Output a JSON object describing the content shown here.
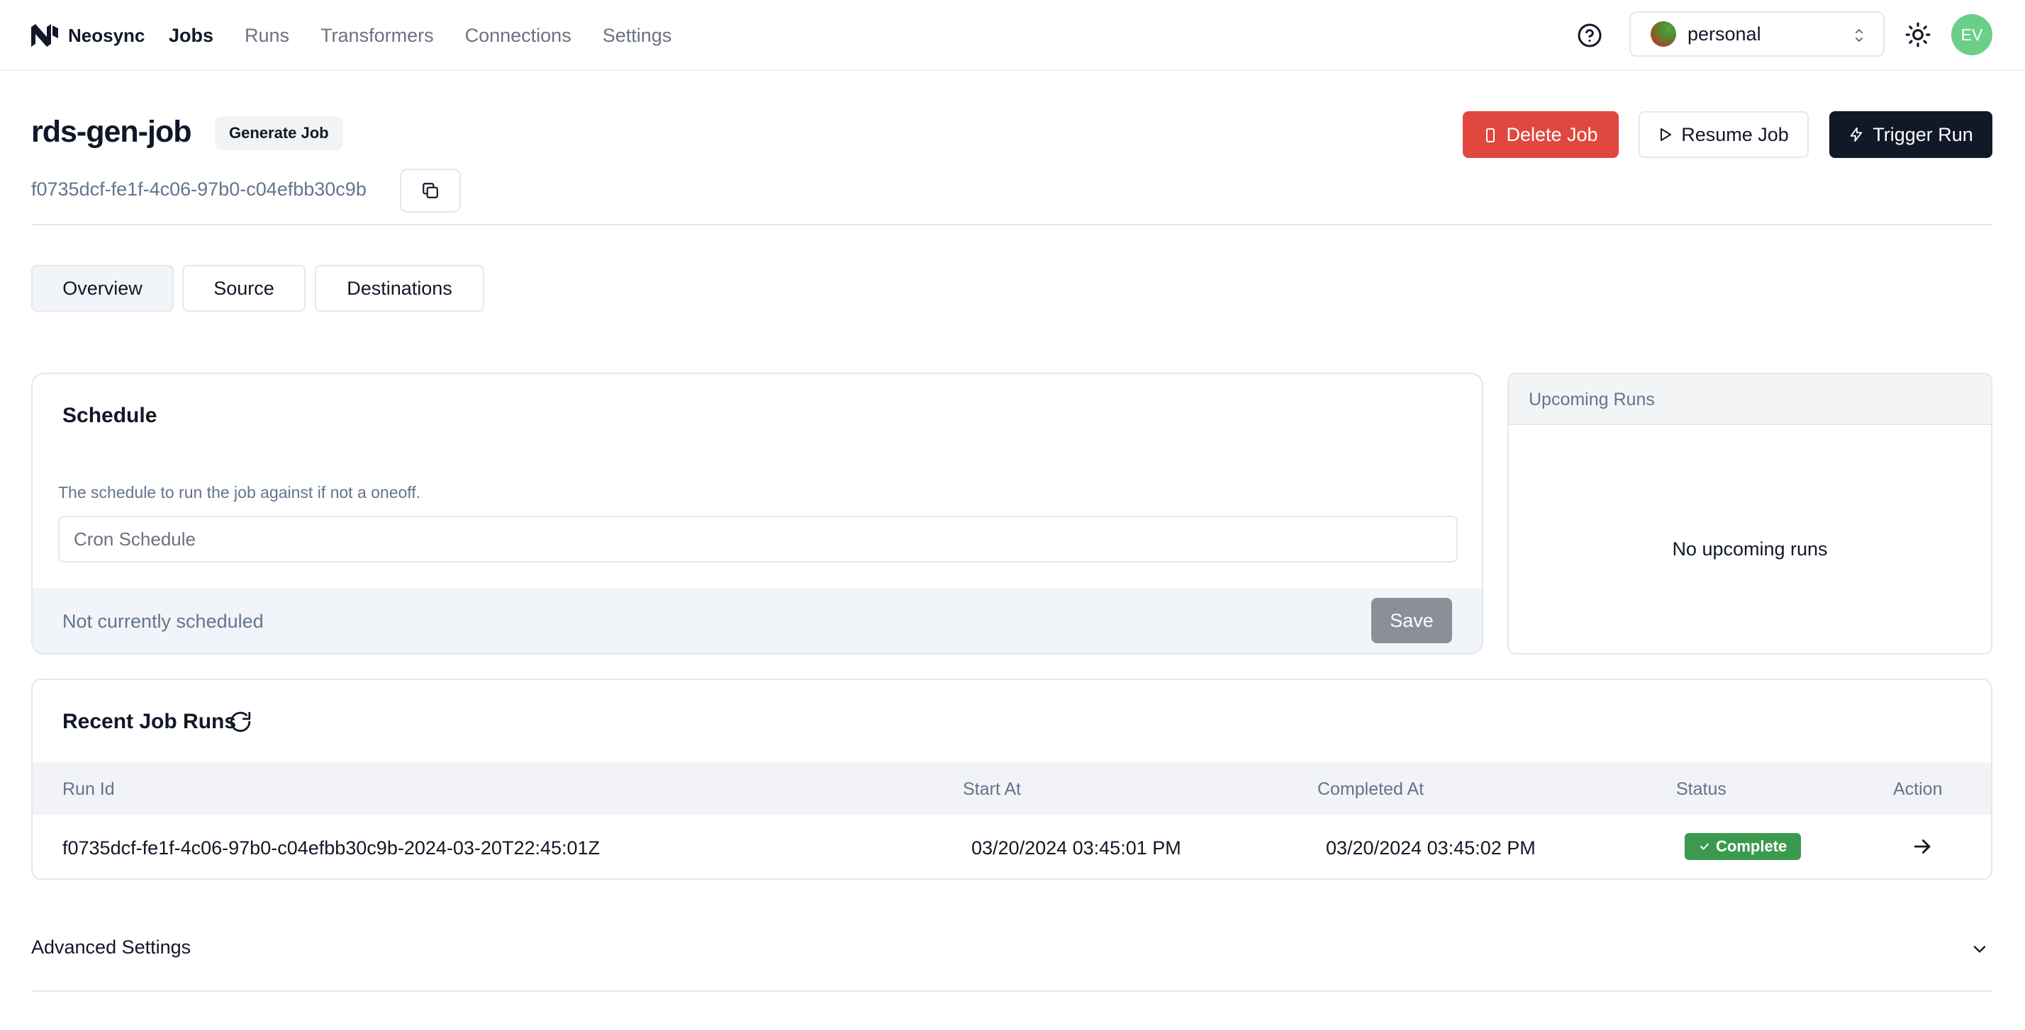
{
  "brand": {
    "name": "Neosync"
  },
  "nav": {
    "items": [
      {
        "label": "Jobs",
        "active": true
      },
      {
        "label": "Runs",
        "active": false
      },
      {
        "label": "Transformers",
        "active": false
      },
      {
        "label": "Connections",
        "active": false
      },
      {
        "label": "Settings",
        "active": false
      }
    ]
  },
  "account": {
    "name": "personal",
    "avatar_initials": "EV"
  },
  "job": {
    "name": "rds-gen-job",
    "type_badge": "Generate Job",
    "id": "f0735dcf-fe1f-4c06-97b0-c04efbb30c9b"
  },
  "actions": {
    "delete_label": "Delete Job",
    "resume_label": "Resume Job",
    "trigger_label": "Trigger Run"
  },
  "tabs": [
    {
      "label": "Overview",
      "active": true
    },
    {
      "label": "Source",
      "active": false
    },
    {
      "label": "Destinations",
      "active": false
    }
  ],
  "schedule": {
    "title": "Schedule",
    "description": "The schedule to run the job against if not a oneoff.",
    "input_value": "",
    "input_placeholder": "Cron Schedule",
    "status": "Not currently scheduled",
    "save_label": "Save"
  },
  "upcoming": {
    "title": "Upcoming Runs",
    "empty_text": "No upcoming runs"
  },
  "recent_runs": {
    "title": "Recent Job Runs",
    "columns": [
      "Run Id",
      "Start At",
      "Completed At",
      "Status",
      "Action"
    ],
    "rows": [
      {
        "run_id": "f0735dcf-fe1f-4c06-97b0-c04efbb30c9b-2024-03-20T22:45:01Z",
        "start_at": "03/20/2024 03:45:01 PM",
        "completed_at": "03/20/2024 03:45:02 PM",
        "status": "Complete"
      }
    ]
  },
  "advanced": {
    "label": "Advanced Settings"
  },
  "colors": {
    "danger": "#e0483f",
    "primary_dark": "#111827",
    "success": "#3b9a4d",
    "avatar": "#6bcf88"
  },
  "icons": [
    "neosync-logo-icon",
    "help-circle-icon",
    "chevron-updown-icon",
    "sun-icon",
    "trash-icon",
    "play-icon",
    "lightning-icon",
    "copy-icon",
    "refresh-icon",
    "check-icon",
    "arrow-right-icon",
    "chevron-down-icon"
  ]
}
